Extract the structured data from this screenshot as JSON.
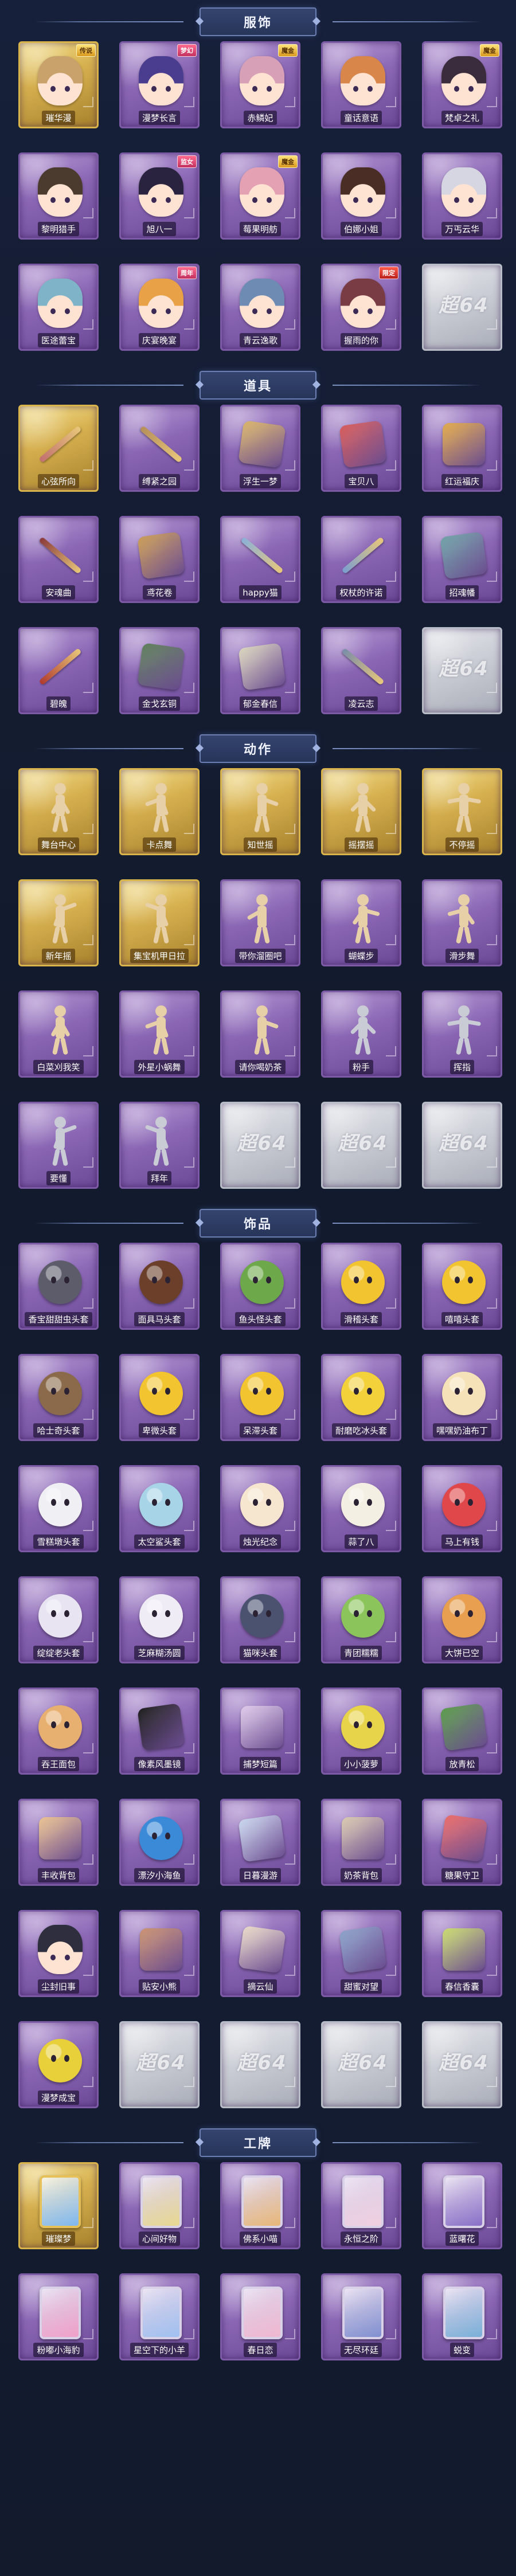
{
  "sections": [
    {
      "title": "服饰",
      "items": [
        {
          "label": "璀华漫",
          "rarity": "gold",
          "tag": "传说",
          "art": "face",
          "color": "#c9a26b"
        },
        {
          "label": "漫梦长言",
          "rarity": "purple",
          "tag": "梦幻",
          "art": "face",
          "color": "#4a3d8f"
        },
        {
          "label": "赤鳞妃",
          "rarity": "purple",
          "tag": "魔金",
          "art": "face",
          "color": "#d8a0b6"
        },
        {
          "label": "童话意语",
          "rarity": "purple",
          "tag": "",
          "art": "face",
          "color": "#d8864a"
        },
        {
          "label": "梵卓之礼",
          "rarity": "purple",
          "tag": "魔金",
          "art": "face",
          "color": "#3a2c3c"
        },
        {
          "label": "黎明猎手",
          "rarity": "purple",
          "tag": "",
          "art": "face",
          "color": "#4b3b2e"
        },
        {
          "label": "旭八一",
          "rarity": "purple",
          "tag": "监女",
          "art": "face",
          "color": "#2a2340"
        },
        {
          "label": "莓果明舫",
          "rarity": "purple",
          "tag": "魔金",
          "art": "face",
          "color": "#e4a1b3"
        },
        {
          "label": "伯娜小姐",
          "rarity": "purple",
          "tag": "",
          "art": "face",
          "color": "#4a2d24"
        },
        {
          "label": "万丐云华",
          "rarity": "purple",
          "tag": "",
          "art": "face",
          "color": "#d6d6e2"
        },
        {
          "label": "医途蕾宝",
          "rarity": "purple",
          "tag": "",
          "art": "face",
          "color": "#7fb4c8"
        },
        {
          "label": "庆宴晚宴",
          "rarity": "purple",
          "tag": "周年",
          "art": "face",
          "color": "#e8a146"
        },
        {
          "label": "青云逸歌",
          "rarity": "purple",
          "tag": "",
          "art": "face",
          "color": "#6d8bb3"
        },
        {
          "label": "握雨的你",
          "rarity": "purple",
          "tag": "限定",
          "art": "face",
          "color": "#7a3c44"
        },
        {
          "label": "",
          "rarity": "empty",
          "tag": "",
          "art": "empty",
          "color": ""
        }
      ]
    },
    {
      "title": "道具",
      "items": [
        {
          "label": "心弦所向",
          "rarity": "gold",
          "tag": "",
          "art": "stick",
          "color": "#c27070"
        },
        {
          "label": "缚紧之园",
          "rarity": "purple",
          "tag": "",
          "art": "stick",
          "color": "#b58e5a"
        },
        {
          "label": "浮生一梦",
          "rarity": "purple",
          "tag": "",
          "art": "obj",
          "color": "#d8b36a"
        },
        {
          "label": "宝贝八",
          "rarity": "purple",
          "tag": "",
          "art": "obj",
          "color": "#d55a5a"
        },
        {
          "label": "红运福庆",
          "rarity": "purple",
          "tag": "",
          "art": "obj",
          "color": "#e0a84a"
        },
        {
          "label": "安魂曲",
          "rarity": "purple",
          "tag": "",
          "art": "stick",
          "color": "#8a3a3a"
        },
        {
          "label": "鸢花卷",
          "rarity": "purple",
          "tag": "",
          "art": "obj",
          "color": "#c99b55"
        },
        {
          "label": "happy猫",
          "rarity": "purple",
          "tag": "",
          "art": "stick",
          "color": "#8bb0d8"
        },
        {
          "label": "权杖的许诺",
          "rarity": "purple",
          "tag": "",
          "art": "stick",
          "color": "#7a9ed0"
        },
        {
          "label": "招魂幡",
          "rarity": "purple",
          "tag": "",
          "art": "obj",
          "color": "#6fa0a6"
        },
        {
          "label": "碧魄",
          "rarity": "purple",
          "tag": "",
          "art": "stick",
          "color": "#b03a2e"
        },
        {
          "label": "金戈玄铜",
          "rarity": "purple",
          "tag": "",
          "art": "obj",
          "color": "#5d7d5a"
        },
        {
          "label": "郁金春信",
          "rarity": "purple",
          "tag": "",
          "art": "obj",
          "color": "#d9d3bd"
        },
        {
          "label": "凌云志",
          "rarity": "purple",
          "tag": "",
          "art": "stick",
          "color": "#7a8da8"
        },
        {
          "label": "",
          "rarity": "empty",
          "tag": "",
          "art": "empty",
          "color": ""
        }
      ]
    },
    {
      "title": "动作",
      "items": [
        {
          "label": "舞台中心",
          "rarity": "gold",
          "tag": "",
          "art": "pose",
          "color": ""
        },
        {
          "label": "卡点舞",
          "rarity": "gold",
          "tag": "",
          "art": "pose",
          "color": ""
        },
        {
          "label": "知世摇",
          "rarity": "gold",
          "tag": "",
          "art": "pose",
          "color": ""
        },
        {
          "label": "摇摆摇",
          "rarity": "gold",
          "tag": "",
          "art": "pose",
          "color": ""
        },
        {
          "label": "不停摇",
          "rarity": "gold",
          "tag": "",
          "art": "pose",
          "color": ""
        },
        {
          "label": "新年摇",
          "rarity": "gold",
          "tag": "",
          "art": "pose",
          "color": ""
        },
        {
          "label": "集宝机甲日拉",
          "rarity": "gold",
          "tag": "",
          "art": "pose",
          "color": ""
        },
        {
          "label": "带你溜圈吧",
          "rarity": "purple",
          "tag": "",
          "art": "pose",
          "color": ""
        },
        {
          "label": "蝴蝶步",
          "rarity": "purple",
          "tag": "",
          "art": "pose",
          "color": ""
        },
        {
          "label": "滑步舞",
          "rarity": "purple",
          "tag": "",
          "art": "pose",
          "color": ""
        },
        {
          "label": "白菜刈我笑",
          "rarity": "purple",
          "tag": "",
          "art": "pose",
          "color": ""
        },
        {
          "label": "外星小蜗舞",
          "rarity": "purple",
          "tag": "",
          "art": "pose",
          "color": ""
        },
        {
          "label": "请你喝奶茶",
          "rarity": "purple",
          "tag": "",
          "art": "pose",
          "color": ""
        },
        {
          "label": "粉手",
          "rarity": "purple",
          "tag": "",
          "art": "pose",
          "color": "grey"
        },
        {
          "label": "挥指",
          "rarity": "purple",
          "tag": "",
          "art": "pose",
          "color": "grey"
        },
        {
          "label": "要懂",
          "rarity": "purple",
          "tag": "",
          "art": "pose",
          "color": "grey"
        },
        {
          "label": "拜年",
          "rarity": "purple",
          "tag": "",
          "art": "pose",
          "color": "grey"
        },
        {
          "label": "",
          "rarity": "empty",
          "tag": "",
          "art": "empty",
          "color": ""
        },
        {
          "label": "",
          "rarity": "empty",
          "tag": "",
          "art": "empty",
          "color": ""
        },
        {
          "label": "",
          "rarity": "empty",
          "tag": "",
          "art": "empty",
          "color": ""
        }
      ]
    },
    {
      "title": "饰品",
      "items": [
        {
          "label": "香宝甜甜虫头套",
          "rarity": "purple",
          "tag": "",
          "art": "blob",
          "color": "#5c5c6a"
        },
        {
          "label": "面具马头套",
          "rarity": "purple",
          "tag": "",
          "art": "blob",
          "color": "#6b3f2a"
        },
        {
          "label": "鱼头怪头套",
          "rarity": "purple",
          "tag": "",
          "art": "blob",
          "color": "#6da84a"
        },
        {
          "label": "滑稽头套",
          "rarity": "purple",
          "tag": "",
          "art": "blob",
          "color": "#f2c530"
        },
        {
          "label": "嘻嘻头套",
          "rarity": "purple",
          "tag": "",
          "art": "blob",
          "color": "#f2c530"
        },
        {
          "label": "哈士奇头套",
          "rarity": "purple",
          "tag": "",
          "art": "blob",
          "color": "#8a6a4a"
        },
        {
          "label": "卑微头套",
          "rarity": "purple",
          "tag": "",
          "art": "blob",
          "color": "#f2c530"
        },
        {
          "label": "呆滞头套",
          "rarity": "purple",
          "tag": "",
          "art": "blob",
          "color": "#f2c530"
        },
        {
          "label": "耐磨吃冰头套",
          "rarity": "purple",
          "tag": "",
          "art": "blob",
          "color": "#f2d13a"
        },
        {
          "label": "嘿嘿奶油布丁",
          "rarity": "purple",
          "tag": "",
          "art": "blob",
          "color": "#f5e2b8"
        },
        {
          "label": "雪糕墩头套",
          "rarity": "purple",
          "tag": "",
          "art": "blob",
          "color": "#f0f0f4"
        },
        {
          "label": "太空鲨头套",
          "rarity": "purple",
          "tag": "",
          "art": "blob",
          "color": "#a8d4e8"
        },
        {
          "label": "烛光纪念",
          "rarity": "purple",
          "tag": "",
          "art": "blob",
          "color": "#f6e6cf"
        },
        {
          "label": "蒜了八",
          "rarity": "purple",
          "tag": "",
          "art": "blob",
          "color": "#f4efe3"
        },
        {
          "label": "马上有钱",
          "rarity": "purple",
          "tag": "",
          "art": "blob",
          "color": "#e0474a"
        },
        {
          "label": "绽绽老头套",
          "rarity": "purple",
          "tag": "",
          "art": "blob",
          "color": "#e8e4f2"
        },
        {
          "label": "芝麻糊汤圆",
          "rarity": "purple",
          "tag": "",
          "art": "blob",
          "color": "#f0ecf6"
        },
        {
          "label": "猫咪头套",
          "rarity": "purple",
          "tag": "",
          "art": "blob",
          "color": "#4a5270"
        },
        {
          "label": "青团糯糯",
          "rarity": "purple",
          "tag": "",
          "art": "blob",
          "color": "#8bc45a"
        },
        {
          "label": "大饼已空",
          "rarity": "purple",
          "tag": "",
          "art": "blob",
          "color": "#e8a050"
        },
        {
          "label": "吞王面包",
          "rarity": "purple",
          "tag": "",
          "art": "blob",
          "color": "#e8b070"
        },
        {
          "label": "像素风墨镜",
          "rarity": "purple",
          "tag": "",
          "art": "obj",
          "color": "#1c1c1c"
        },
        {
          "label": "捕梦短篇",
          "rarity": "purple",
          "tag": "",
          "art": "obj",
          "color": "#dcc8e8"
        },
        {
          "label": "小小菠萝",
          "rarity": "purple",
          "tag": "",
          "art": "blob",
          "color": "#e8d44a"
        },
        {
          "label": "放青松",
          "rarity": "purple",
          "tag": "",
          "art": "obj",
          "color": "#5a9a4a"
        },
        {
          "label": "丰收背包",
          "rarity": "purple",
          "tag": "",
          "art": "obj",
          "color": "#e8c090"
        },
        {
          "label": "漂汐小海鱼",
          "rarity": "purple",
          "tag": "",
          "art": "blob",
          "color": "#3a8ad8"
        },
        {
          "label": "日暮漫游",
          "rarity": "purple",
          "tag": "",
          "art": "obj",
          "color": "#c8d4ec"
        },
        {
          "label": "奶茶背包",
          "rarity": "purple",
          "tag": "",
          "art": "obj",
          "color": "#d8c8b0"
        },
        {
          "label": "糖果守卫",
          "rarity": "purple",
          "tag": "",
          "art": "obj",
          "color": "#e86a6a"
        },
        {
          "label": "尘封旧事",
          "rarity": "purple",
          "tag": "",
          "art": "face",
          "color": "#2e2e3e"
        },
        {
          "label": "贴安小熊",
          "rarity": "purple",
          "tag": "",
          "art": "obj",
          "color": "#c89070"
        },
        {
          "label": "摘云仙",
          "rarity": "purple",
          "tag": "",
          "art": "obj",
          "color": "#e8d8c8"
        },
        {
          "label": "甜蜜对望",
          "rarity": "purple",
          "tag": "",
          "art": "obj",
          "color": "#8aa0c8"
        },
        {
          "label": "春信香囊",
          "rarity": "purple",
          "tag": "",
          "art": "obj",
          "color": "#c8d870"
        },
        {
          "label": "漫梦成宝",
          "rarity": "purple",
          "tag": "",
          "art": "blob",
          "color": "#e8d03a"
        },
        {
          "label": "",
          "rarity": "empty",
          "tag": "",
          "art": "empty",
          "color": ""
        },
        {
          "label": "",
          "rarity": "empty",
          "tag": "",
          "art": "empty",
          "color": ""
        },
        {
          "label": "",
          "rarity": "empty",
          "tag": "",
          "art": "empty",
          "color": ""
        },
        {
          "label": "",
          "rarity": "empty",
          "tag": "",
          "art": "empty",
          "color": ""
        }
      ]
    },
    {
      "title": "工牌",
      "items": [
        {
          "label": "璀璨梦",
          "rarity": "gold",
          "tag": "",
          "art": "card",
          "color": "#7fb8f0"
        },
        {
          "label": "心间好物",
          "rarity": "purple",
          "tag": "",
          "art": "card",
          "color": "#e8d890"
        },
        {
          "label": "佛系小喵",
          "rarity": "purple",
          "tag": "",
          "art": "card",
          "color": "#e8b878"
        },
        {
          "label": "永恒之阶",
          "rarity": "purple",
          "tag": "",
          "art": "card",
          "color": "#f0d0e0"
        },
        {
          "label": "蓝曙花",
          "rarity": "purple",
          "tag": "",
          "art": "card",
          "color": "#8a70c8"
        },
        {
          "label": "粉嘟小海豹",
          "rarity": "purple",
          "tag": "",
          "art": "card",
          "color": "#f0a0c8"
        },
        {
          "label": "星空下的小羊",
          "rarity": "purple",
          "tag": "",
          "art": "card",
          "color": "#a0c0f0"
        },
        {
          "label": "春日恋",
          "rarity": "purple",
          "tag": "",
          "art": "card",
          "color": "#f0b8d0"
        },
        {
          "label": "无尽环廷",
          "rarity": "purple",
          "tag": "",
          "art": "card",
          "color": "#8090d0"
        },
        {
          "label": "蜕变",
          "rarity": "purple",
          "tag": "",
          "art": "card",
          "color": "#7ab0d8"
        }
      ]
    }
  ],
  "empty_placeholder_text": "超64"
}
